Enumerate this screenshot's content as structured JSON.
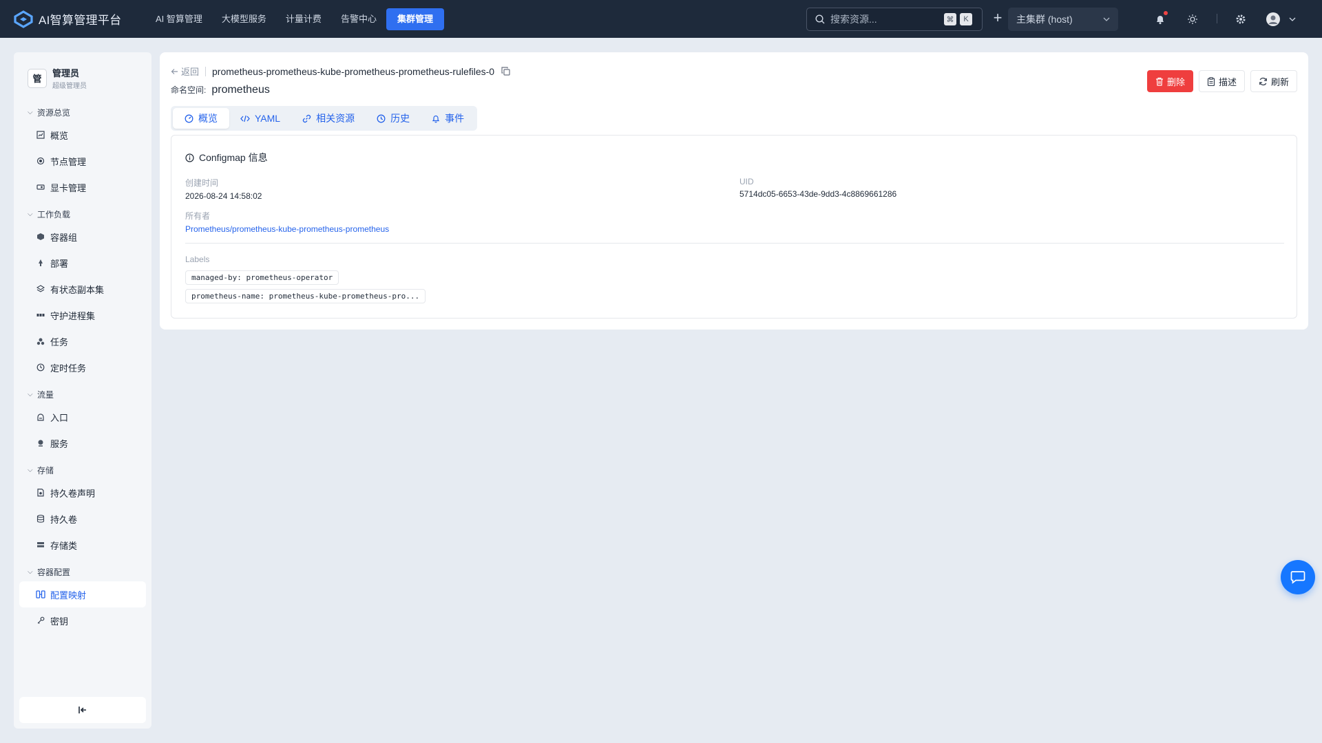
{
  "app": {
    "title": "AI智算管理平台"
  },
  "topnav": [
    {
      "label": "AI 智算管理"
    },
    {
      "label": "大模型服务"
    },
    {
      "label": "计量计费"
    },
    {
      "label": "告警中心"
    },
    {
      "label": "集群管理",
      "active": true
    }
  ],
  "search": {
    "placeholder": "搜索资源...",
    "kbd1": "⌘",
    "kbd2": "K"
  },
  "cluster": {
    "selected": "主集群 (host)"
  },
  "user": {
    "name": "管理员",
    "role": "超级管理员",
    "avatar_char": "管"
  },
  "sidebar": {
    "groups": [
      {
        "title": "资源总览",
        "items": [
          {
            "label": "概览",
            "icon": "chart-icon"
          },
          {
            "label": "节点管理",
            "icon": "node-icon"
          },
          {
            "label": "显卡管理",
            "icon": "gpu-icon"
          }
        ]
      },
      {
        "title": "工作负载",
        "items": [
          {
            "label": "容器组",
            "icon": "cube-icon"
          },
          {
            "label": "部署",
            "icon": "deploy-icon"
          },
          {
            "label": "有状态副本集",
            "icon": "layers-icon"
          },
          {
            "label": "守护进程集",
            "icon": "daemon-icon"
          },
          {
            "label": "任务",
            "icon": "task-icon"
          },
          {
            "label": "定时任务",
            "icon": "clock-icon"
          }
        ]
      },
      {
        "title": "流量",
        "items": [
          {
            "label": "入口",
            "icon": "ingress-icon"
          },
          {
            "label": "服务",
            "icon": "service-icon"
          }
        ]
      },
      {
        "title": "存储",
        "items": [
          {
            "label": "持久卷声明",
            "icon": "pvc-icon"
          },
          {
            "label": "持久卷",
            "icon": "database-icon"
          },
          {
            "label": "存储类",
            "icon": "storage-class-icon"
          }
        ]
      },
      {
        "title": "容器配置",
        "items": [
          {
            "label": "配置映射",
            "icon": "configmap-icon",
            "active": true
          },
          {
            "label": "密钥",
            "icon": "key-icon"
          }
        ]
      }
    ]
  },
  "detail": {
    "back_label": "返回",
    "resource_name": "prometheus-prometheus-kube-prometheus-prometheus-rulefiles-0",
    "namespace_label": "命名空间:",
    "namespace": "prometheus",
    "actions": {
      "delete": "删除",
      "describe": "描述",
      "refresh": "刷新"
    },
    "tabs": [
      {
        "label": "概览",
        "icon": "dashboard-icon",
        "active": true
      },
      {
        "label": "YAML",
        "icon": "code-icon"
      },
      {
        "label": "相关资源",
        "icon": "link-icon"
      },
      {
        "label": "历史",
        "icon": "history-icon"
      },
      {
        "label": "事件",
        "icon": "bell-icon"
      }
    ],
    "card_title": "Configmap 信息",
    "created_label": "创建时间",
    "created_value": "2026-08-24 14:58:02",
    "uid_label": "UID",
    "uid_value": "5714dc05-6653-43de-9dd3-4c8869661286",
    "owner_label": "所有者",
    "owner_value": "Prometheus/prometheus-kube-prometheus-prometheus",
    "labels_label": "Labels",
    "labels": [
      "managed-by: prometheus-operator",
      "prometheus-name: prometheus-kube-prometheus-pro..."
    ]
  },
  "colors": {
    "topbar": "#1e2a3b",
    "accent": "#2f6ff0",
    "danger": "#ef3e3e",
    "link": "#2563eb"
  }
}
